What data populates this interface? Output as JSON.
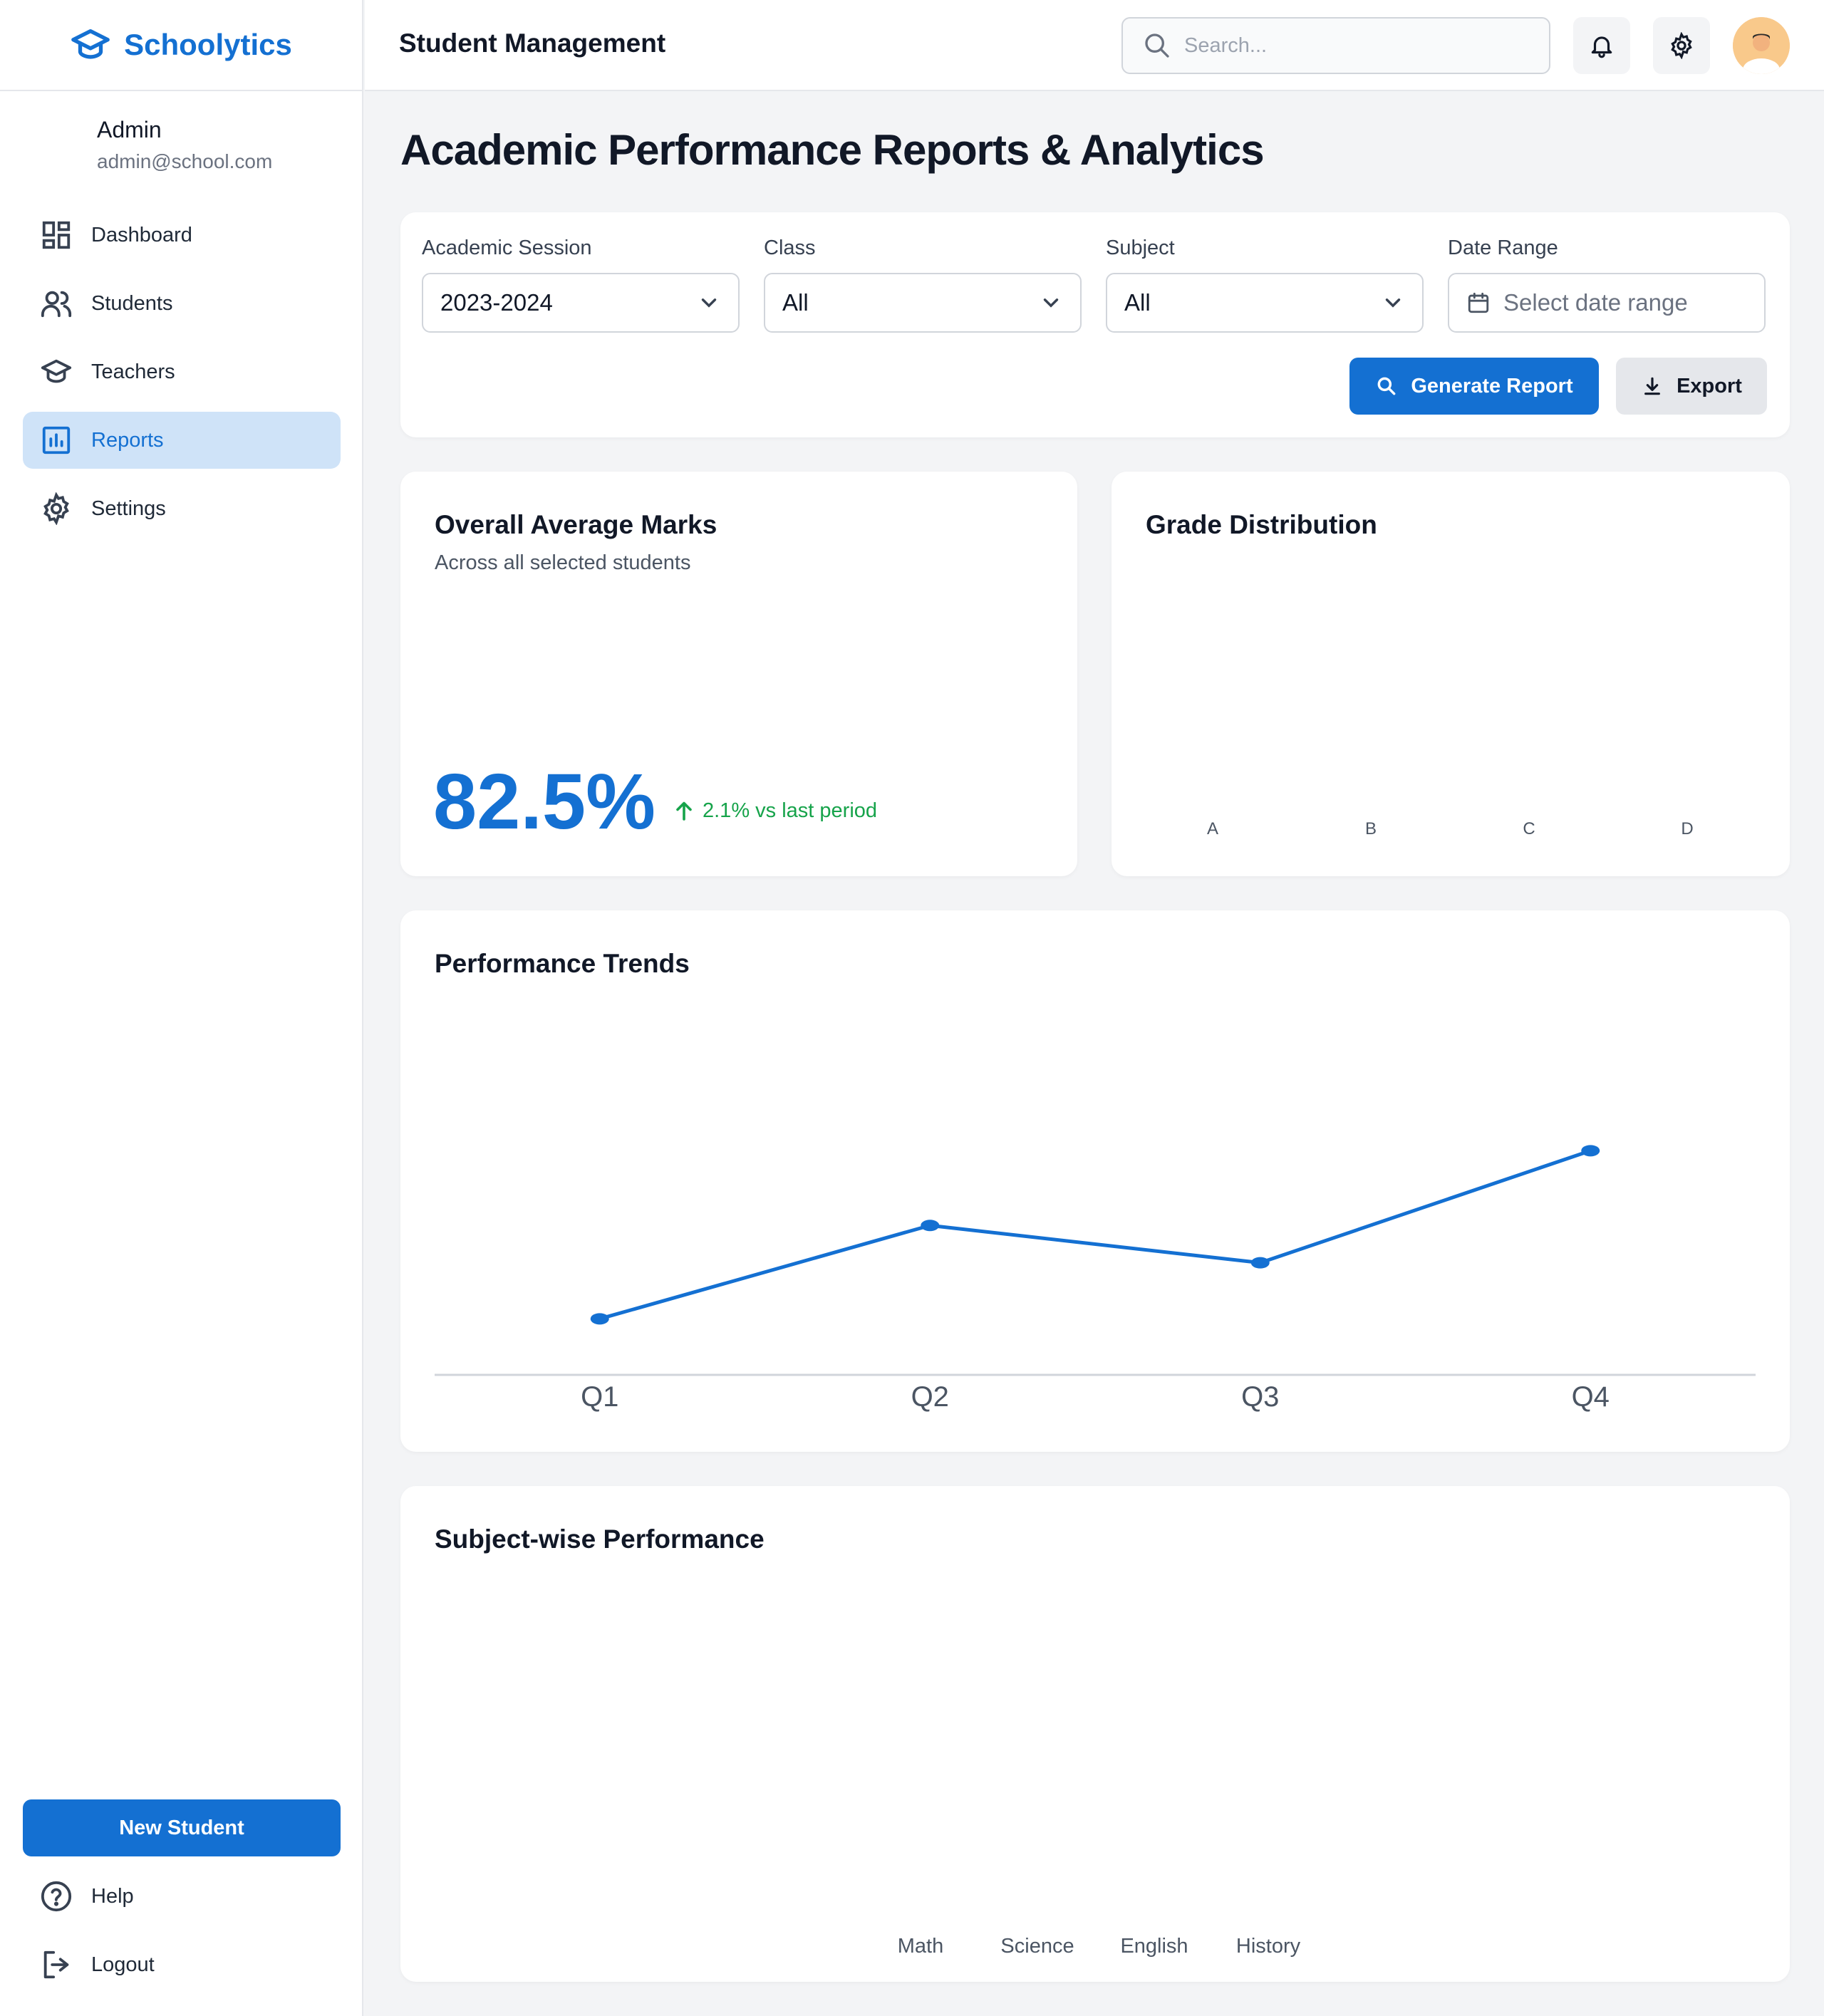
{
  "brand": {
    "name": "Schoolytics"
  },
  "user": {
    "name": "Admin",
    "email": "admin@school.com"
  },
  "nav": {
    "items": [
      {
        "label": "Dashboard",
        "icon": "dashboard-icon"
      },
      {
        "label": "Students",
        "icon": "users-icon"
      },
      {
        "label": "Teachers",
        "icon": "graduation-cap-icon"
      },
      {
        "label": "Reports",
        "icon": "bar-chart-icon",
        "active": true
      },
      {
        "label": "Settings",
        "icon": "gear-icon"
      }
    ],
    "new_student_label": "New Student",
    "help_label": "Help",
    "logout_label": "Logout"
  },
  "header": {
    "title": "Student Management",
    "search_placeholder": "Search..."
  },
  "page": {
    "title": "Academic Performance Reports & Analytics"
  },
  "filters": {
    "session": {
      "label": "Academic Session",
      "value": "2023-2024"
    },
    "class": {
      "label": "Class",
      "value": "All"
    },
    "subject": {
      "label": "Subject",
      "value": "All"
    },
    "date_range": {
      "label": "Date Range",
      "placeholder": "Select date range"
    },
    "generate_label": "Generate Report",
    "export_label": "Export"
  },
  "average": {
    "title": "Overall Average Marks",
    "subtitle": "Across all selected students",
    "value": "82.5%",
    "change": "2.1% vs last period"
  },
  "grade_distribution": {
    "title": "Grade Distribution",
    "labels": [
      "A",
      "B",
      "C",
      "D"
    ]
  },
  "trends": {
    "title": "Performance Trends"
  },
  "subjects": {
    "title": "Subject-wise Performance",
    "labels": [
      "Math",
      "Science",
      "English",
      "History"
    ]
  },
  "colors": {
    "accent": "#1470d2",
    "positive": "#16a34a",
    "active_bg": "#cfe3f8"
  },
  "chart_data": {
    "type": "line",
    "categories": [
      "Q1",
      "Q2",
      "Q3",
      "Q4"
    ],
    "series": [
      {
        "values": [
          74,
          79,
          77,
          83
        ]
      }
    ],
    "ylim": [
      71,
      89
    ],
    "grid": false
  }
}
